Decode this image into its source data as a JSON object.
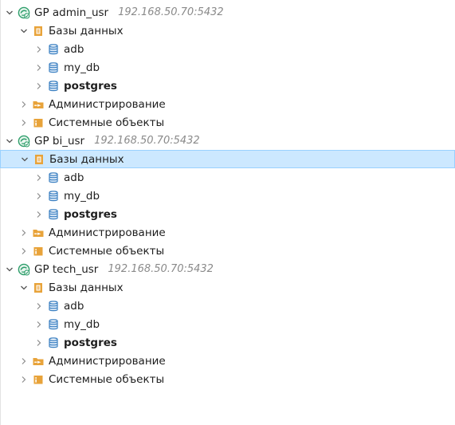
{
  "connections": [
    {
      "name": "GP admin_usr",
      "address": "192.168.50.70:5432",
      "expanded": true,
      "folders": [
        {
          "label": "Базы данных",
          "expanded": true,
          "selected": false,
          "databases": [
            {
              "label": "adb",
              "bold": false
            },
            {
              "label": "my_db",
              "bold": false
            },
            {
              "label": "postgres",
              "bold": true
            }
          ]
        },
        {
          "label": "Администрирование",
          "expanded": false
        },
        {
          "label": "Системные объекты",
          "expanded": false
        }
      ]
    },
    {
      "name": "GP bi_usr",
      "address": "192.168.50.70:5432",
      "expanded": true,
      "folders": [
        {
          "label": "Базы данных",
          "expanded": true,
          "selected": true,
          "databases": [
            {
              "label": "adb",
              "bold": false
            },
            {
              "label": "my_db",
              "bold": false
            },
            {
              "label": "postgres",
              "bold": true
            }
          ]
        },
        {
          "label": "Администрирование",
          "expanded": false
        },
        {
          "label": "Системные объекты",
          "expanded": false
        }
      ]
    },
    {
      "name": "GP tech_usr",
      "address": "192.168.50.70:5432",
      "expanded": true,
      "folders": [
        {
          "label": "Базы данных",
          "expanded": true,
          "selected": false,
          "databases": [
            {
              "label": "adb",
              "bold": false
            },
            {
              "label": "my_db",
              "bold": false
            },
            {
              "label": "postgres",
              "bold": true
            }
          ]
        },
        {
          "label": "Администрирование",
          "expanded": false
        },
        {
          "label": "Системные объекты",
          "expanded": false
        }
      ]
    }
  ],
  "colors": {
    "selection": "#cce8ff",
    "selection_border": "#99d1ff",
    "folder": "#e8a33a",
    "database": "#3a7fc1",
    "connection": "#2e9e6b",
    "address": "#8a8a8a"
  },
  "icons": {
    "connection": "greenplum-connection-icon",
    "folder": "database-folder-icon",
    "admin": "admin-folder-icon",
    "system": "system-objects-folder-icon",
    "database": "database-icon",
    "expanded": "chevron-down-icon",
    "collapsed": "chevron-right-icon"
  }
}
